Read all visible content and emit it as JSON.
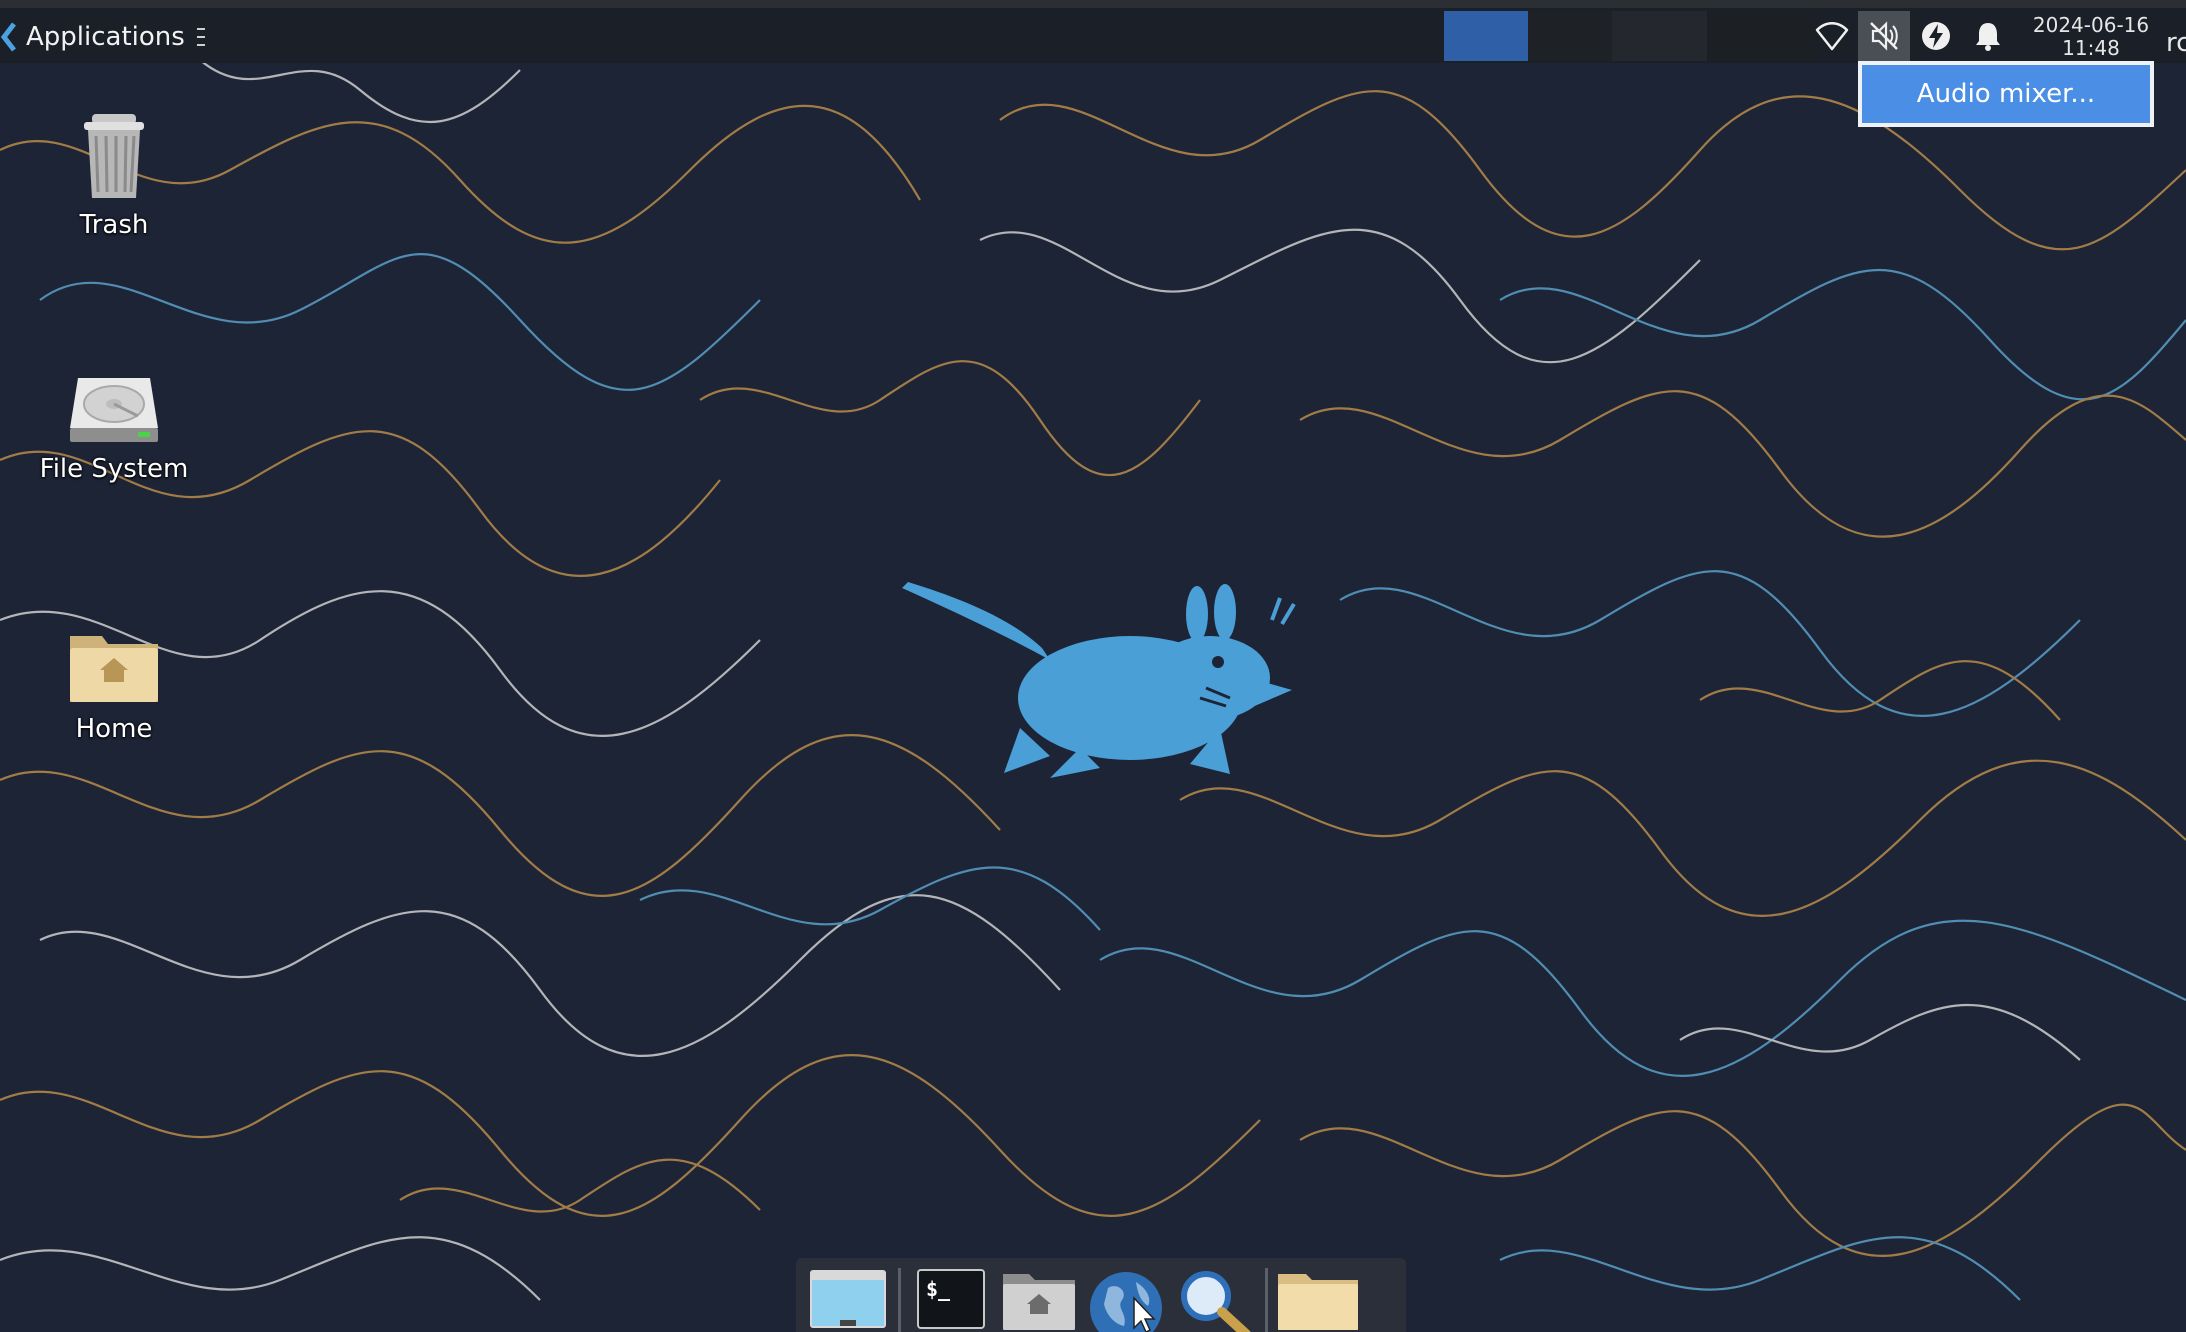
{
  "panel": {
    "applications_label": "Applications",
    "clock_date": "2024-06-16",
    "clock_time": "11:48",
    "user_label_partial": "rc",
    "tray_icons": [
      "wifi-icon",
      "audio-muted-icon",
      "power-icon",
      "notification-bell-icon"
    ]
  },
  "audio_popup": {
    "item_label": "Audio mixer..."
  },
  "desktop_icons": [
    {
      "label": "Trash",
      "icon": "trash-icon"
    },
    {
      "label": "File System",
      "icon": "hard-drive-icon"
    },
    {
      "label": "Home",
      "icon": "home-folder-icon"
    }
  ],
  "dock": {
    "items": [
      "show-desktop-icon",
      "terminal-icon",
      "home-folder-icon",
      "web-browser-icon",
      "search-icon",
      "folder-icon"
    ]
  },
  "colors": {
    "wallpaper_bg": "#1d2436",
    "accent_blue": "#4a8fe5",
    "mascot_blue": "#4a9fd6",
    "panel_bg": "#1b1f27"
  }
}
